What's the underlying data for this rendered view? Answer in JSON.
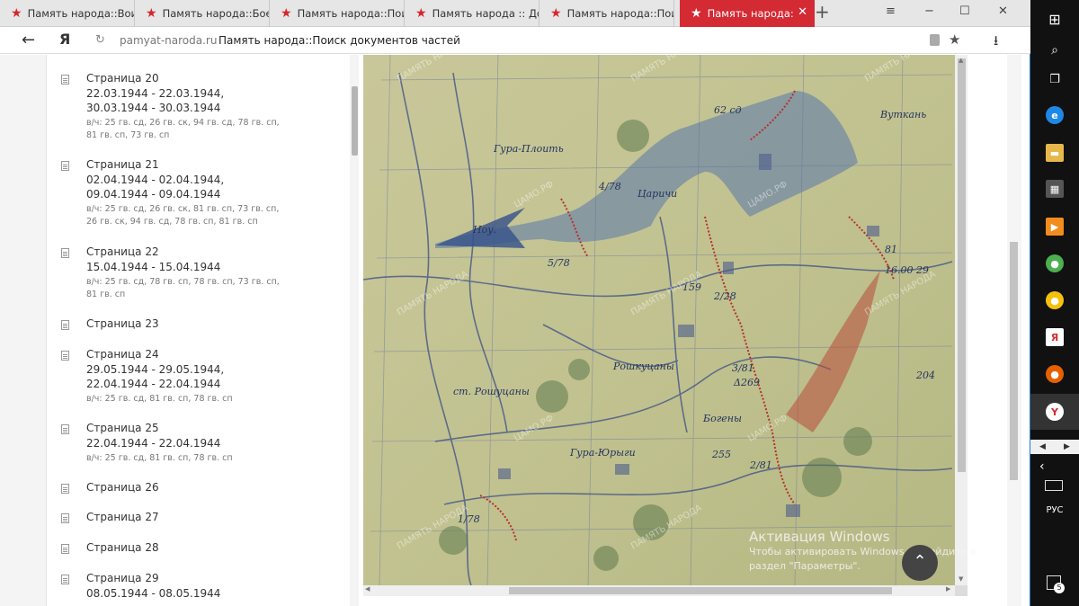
{
  "browser": {
    "tabs": [
      {
        "label": "Память народа::Воинс",
        "active": false
      },
      {
        "label": "Память народа::Боевое",
        "active": false
      },
      {
        "label": "Память народа::Поиск",
        "active": false
      },
      {
        "label": "Память народа :: Доне",
        "active": false
      },
      {
        "label": "Память народа::Поис",
        "active": false
      },
      {
        "label": "Память народа::По",
        "active": true
      }
    ],
    "new_tab": "+",
    "window_controls": {
      "menu": "≡",
      "minimize": "−",
      "maximize": "☐",
      "close": "✕"
    },
    "address": {
      "back": "←",
      "logo": "Я",
      "reload": "↻",
      "host": "pamyat-naroda.ru",
      "title": "Память народа::Поиск документов частей",
      "bookmark": "★",
      "download": "⭳"
    }
  },
  "pages": [
    {
      "title": "Страница 20",
      "dates": "22.03.1944 - 22.03.1944, 30.03.1944 - 30.03.1944",
      "units": "в/ч: 25 гв. сд, 26 гв. ск, 94 гв. сд, 78 гв. сп, 81 гв. сп, 73 гв. сп"
    },
    {
      "title": "Страница 21",
      "dates": "02.04.1944 - 02.04.1944, 09.04.1944 - 09.04.1944",
      "units": "в/ч: 25 гв. сд, 26 гв. ск, 81 гв. сп, 73 гв. сп, 26 гв. ск, 94 гв. сд, 78 гв. сп, 81 гв. сп"
    },
    {
      "title": "Страница 22",
      "dates": "15.04.1944 - 15.04.1944",
      "units": "в/ч: 25 гв. сд, 78 гв. сп, 78 гв. сп, 73 гв. сп, 81 гв. сп"
    },
    {
      "title": "Страница 23",
      "dates": "",
      "units": ""
    },
    {
      "title": "Страница 24",
      "dates": "29.05.1944 - 29.05.1944, 22.04.1944 - 22.04.1944",
      "units": "в/ч: 25 гв. сд, 81 гв. сп, 78 гв. сп"
    },
    {
      "title": "Страница 25",
      "dates": "22.04.1944 - 22.04.1944",
      "units": "в/ч: 25 гв. сд, 81 гв. сп, 78 гв. сп"
    },
    {
      "title": "Страница 26",
      "dates": "",
      "units": ""
    },
    {
      "title": "Страница 27",
      "dates": "",
      "units": ""
    },
    {
      "title": "Страница 28",
      "dates": "",
      "units": ""
    },
    {
      "title": "Страница 29",
      "dates": "08.05.1944 - 08.05.1944",
      "units": ""
    }
  ],
  "map": {
    "watermark": "ПАМЯТЬ НАРОДА",
    "watermark_small": "ЦАМО.РФ",
    "labels": {
      "vutkany": "Вуткань",
      "gura_ploty": "Гура-Плоить",
      "tsarichi": "Царичи",
      "roshtshany": "Рошкуцаны",
      "gura_yurgi": "Гура-Юрыги",
      "bogeny": "Богены",
      "st_roshtshany": "ст. Рошуцаны",
      "noy": "Ноу.",
      "u62": "62 сд",
      "u478": "4/78",
      "u578": "5/78",
      "u228": "2/28",
      "u178": "1/78",
      "u381": "3/81",
      "u269": "Δ269",
      "u255": "255",
      "u81": "81",
      "u81b": "2/81",
      "u1600": "16.00 29",
      "u159": "159",
      "u204": "204"
    }
  },
  "activation": {
    "title": "Активация Windows",
    "subtitle": "Чтобы активировать Windows, перейдите в раздел \"Параметры\"."
  },
  "scroll_top": "⌃",
  "taskbar": {
    "lang": "РУС",
    "notification_count": "5",
    "apps": [
      {
        "icon": "edge-icon",
        "color": "#1e88e5",
        "glyph": "e"
      },
      {
        "icon": "file-explorer-icon",
        "color": "#e6b84b",
        "glyph": "▬"
      },
      {
        "icon": "store-icon",
        "color": "#555",
        "glyph": "▦"
      },
      {
        "icon": "media-player-icon",
        "color": "#f28c1e",
        "glyph": "▶"
      },
      {
        "icon": "chrome-icon",
        "color": "#4caf50",
        "glyph": "●"
      },
      {
        "icon": "chrome-canary-icon",
        "color": "#f4c20d",
        "glyph": "●"
      },
      {
        "icon": "yandex-app-icon",
        "color": "#d32f2f",
        "glyph": "Я"
      },
      {
        "icon": "firefox-icon",
        "color": "#e66000",
        "glyph": "●"
      },
      {
        "icon": "yandex-browser-icon",
        "color": "#d42a34",
        "glyph": "Y"
      }
    ]
  }
}
